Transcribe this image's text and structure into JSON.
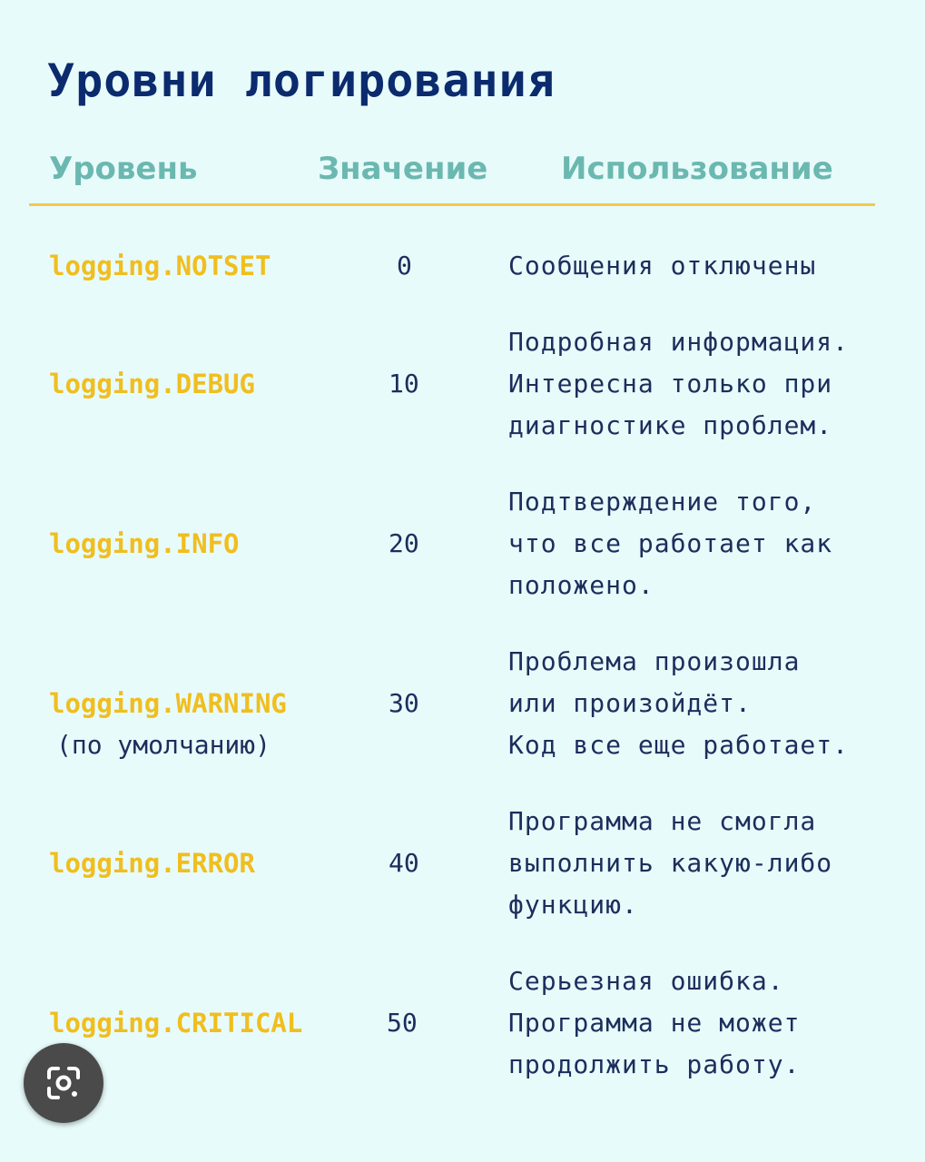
{
  "title": "Уровни логирования",
  "header": {
    "level": "Уровень",
    "value": "Значение",
    "usage": "Использование"
  },
  "rows": [
    {
      "level": "logging.NOTSET",
      "note": "",
      "value": "0",
      "usage": [
        "Сообщения отключены"
      ]
    },
    {
      "level": "logging.DEBUG",
      "note": "",
      "value": "10",
      "usage": [
        "Подробная информация.",
        "Интересна только при",
        "диагностике проблем."
      ]
    },
    {
      "level": "logging.INFO",
      "note": "",
      "value": "20",
      "usage": [
        "Подтверждение того,",
        "что все работает как",
        "положено."
      ]
    },
    {
      "level": "logging.WARNING",
      "note": "(по умолчанию)",
      "value": "30",
      "usage": [
        "Проблема произошла",
        "или произойдёт.",
        "Код все еще работает."
      ]
    },
    {
      "level": "logging.ERROR",
      "note": "",
      "value": "40",
      "usage": [
        "Программа не смогла",
        "выполнить какую-либо",
        "функцию."
      ]
    },
    {
      "level": "logging.CRITICAL",
      "note": "",
      "value": "50",
      "usage": [
        "Серьезная ошибка.",
        "Программа не может",
        "продолжить работу."
      ]
    }
  ],
  "colors": {
    "background": "#e8fbfb",
    "title": "#0b2b6e",
    "header": "#6bb8b0",
    "accent": "#f2c94c",
    "level": "#f0be1e",
    "text": "#1c2e5c"
  },
  "overlay": {
    "icon": "lens-search-icon"
  }
}
